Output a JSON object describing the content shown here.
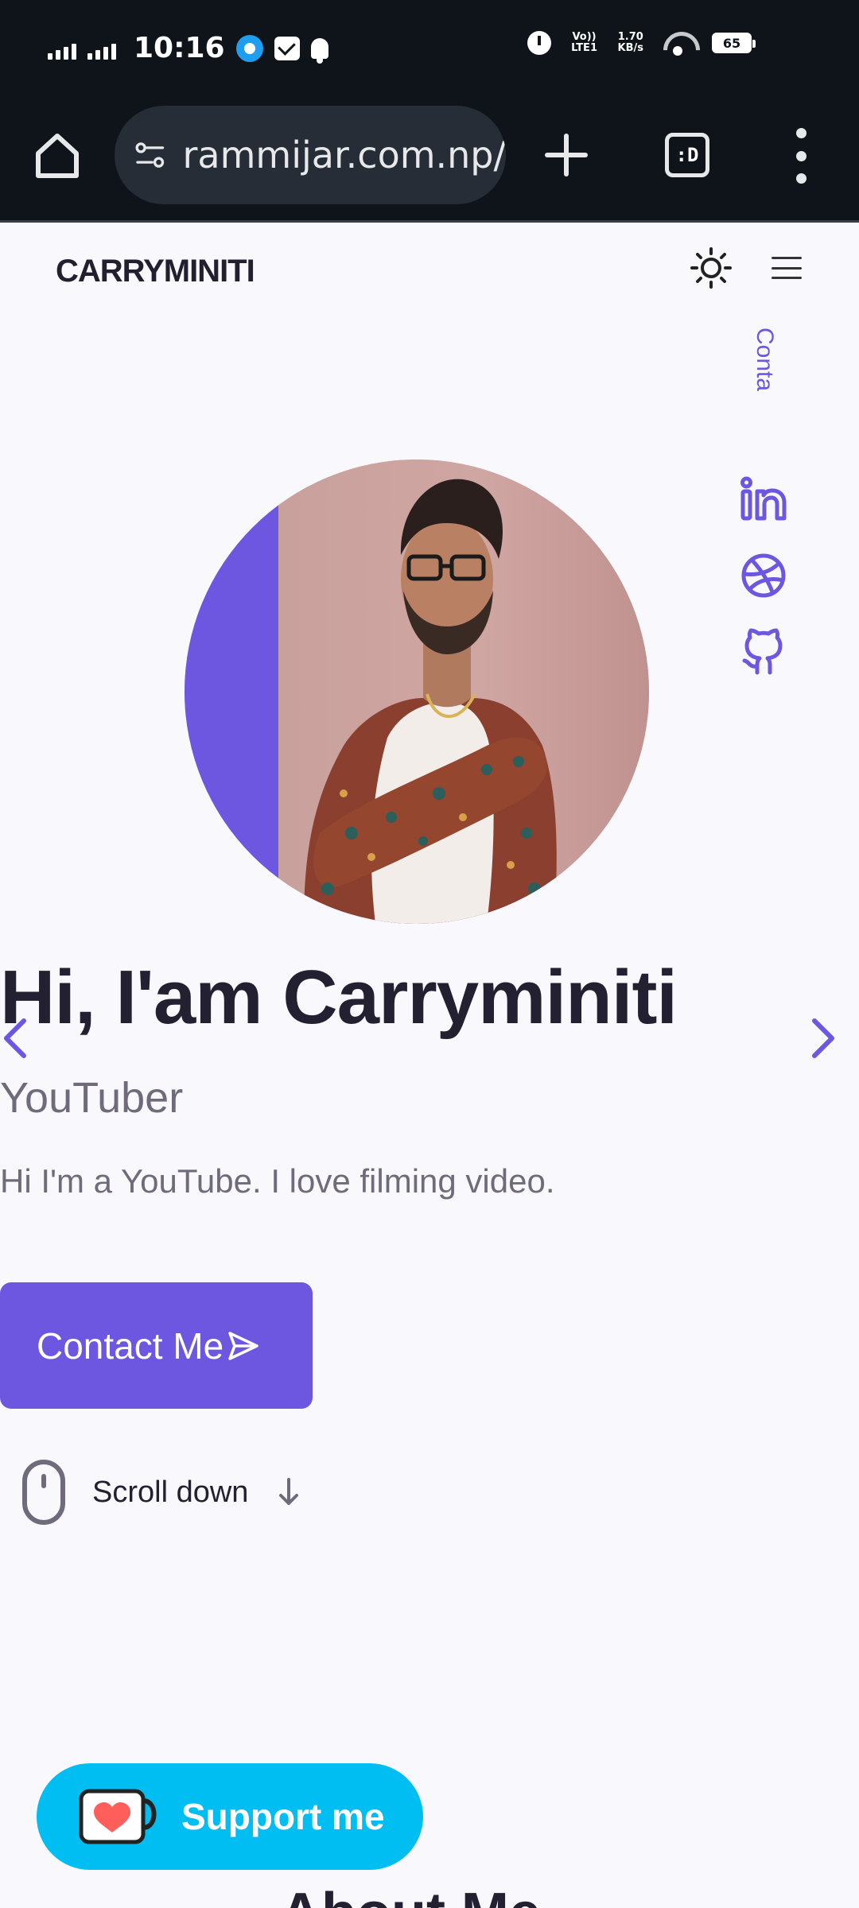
{
  "status_bar": {
    "time": "10:16",
    "network_label": "Vo)) LTE1",
    "speed": "1.70",
    "speed_unit": "KB/s",
    "battery": "65"
  },
  "browser": {
    "url": "rammijar.com.np/",
    "tab_switcher_label": ":D"
  },
  "header": {
    "logo": "CARRYMINITI"
  },
  "hero": {
    "vertical_link": "Contact Me",
    "title": "Hi, I'am Carryminiti",
    "role": "YouTuber",
    "description": "Hi I'm a YouTube. I love filming video.",
    "contact_label": "Contact Me",
    "scroll_label": "Scroll down"
  },
  "socials": [
    "linkedin-icon",
    "dribbble-icon",
    "github-icon"
  ],
  "support": {
    "label": "Support me"
  },
  "about": {
    "heading_peek": "About Me"
  },
  "colors": {
    "accent": "#6d57e0",
    "support": "#00bdf2",
    "page_bg": "#f9f8fd",
    "chrome_bg": "#0f141b"
  }
}
